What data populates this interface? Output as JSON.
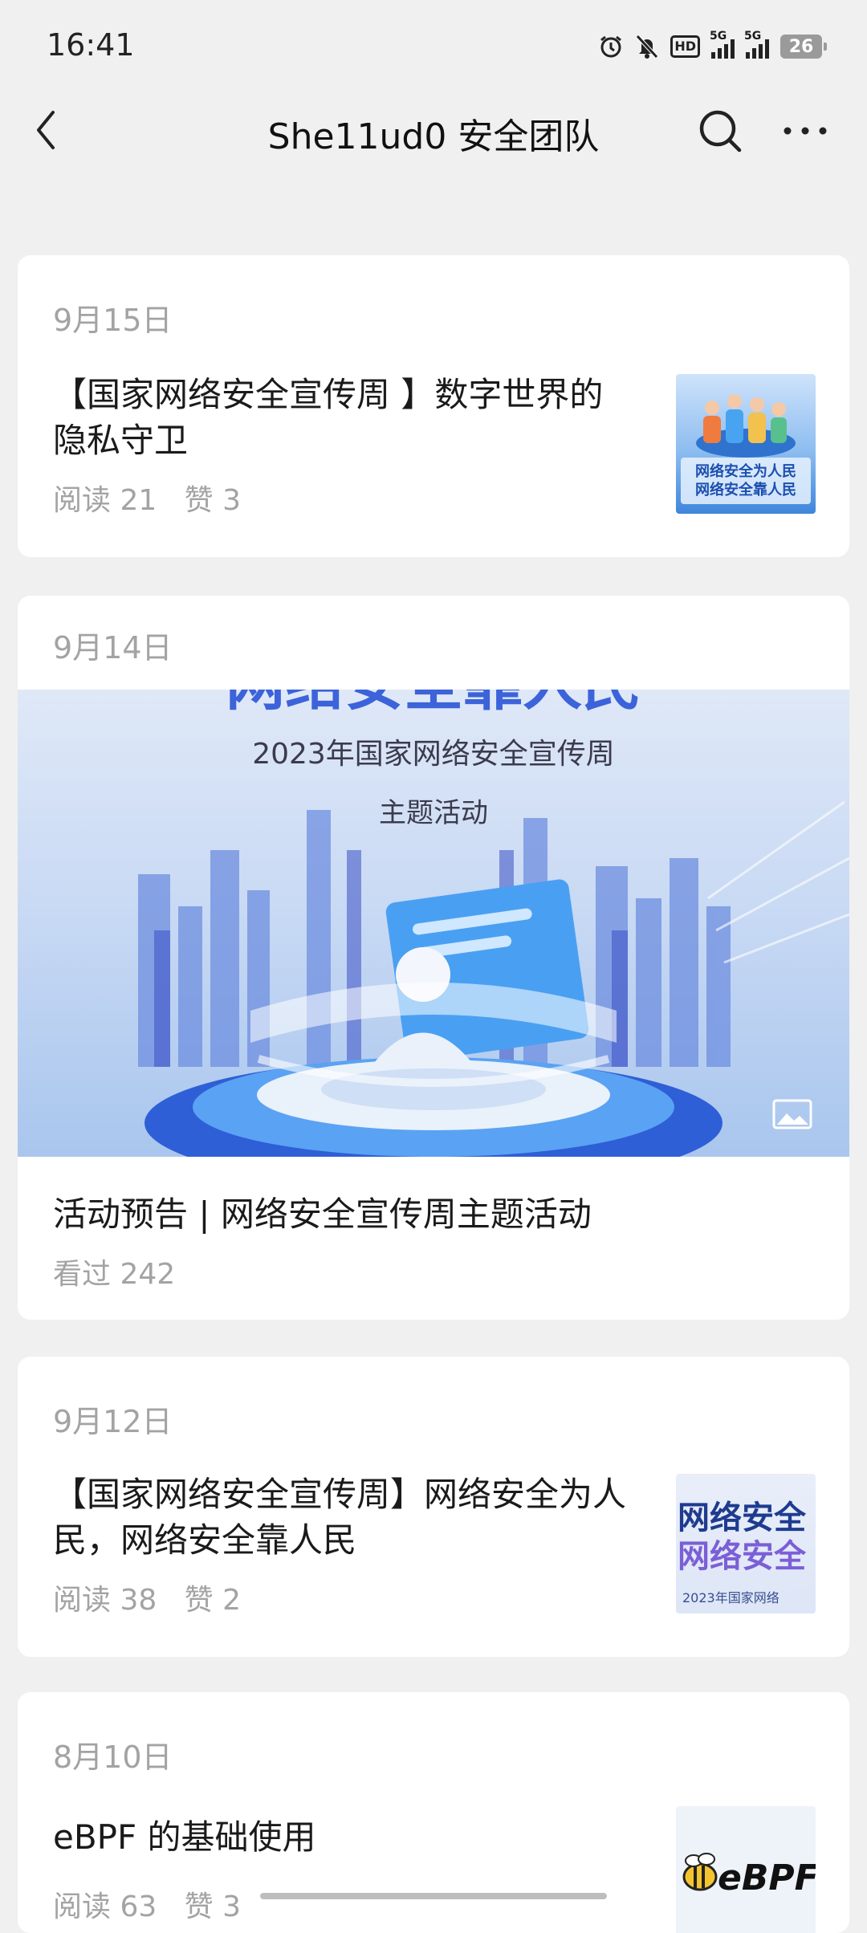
{
  "status_bar": {
    "time": "16:41",
    "battery": "26",
    "network_1": "5G",
    "network_2": "5G",
    "hd": "HD",
    "icons": [
      "alarm-icon",
      "bell-muted-icon",
      "hd-icon",
      "signal-5g-icon",
      "signal-5g-icon",
      "battery-icon"
    ]
  },
  "header": {
    "title": "She11ud0 安全团队",
    "icons": [
      "back-arrow-icon",
      "search-icon",
      "more-icon"
    ]
  },
  "articles": [
    {
      "date": "9月15日",
      "title_line1": "【国家网络安全宣传周 】数字世界的",
      "title_line2": "隐私守卫",
      "read_label": "阅读",
      "read_count": "21",
      "like_label": "赞",
      "like_count": "3",
      "thumb_text_1": "网络安全为人民",
      "thumb_text_2": "网络安全靠人民"
    },
    {
      "date": "9月14日",
      "banner_top": "网络安全靠人民",
      "banner_line1": "2023年国家网络安全宣传周",
      "banner_line2": "主题活动",
      "title": "活动预告 | 网络安全宣传周主题活动",
      "views_label": "看过",
      "views_count": "242",
      "image_icon": "image-icon"
    },
    {
      "date": "9月12日",
      "title_line1": "【国家网络安全宣传周】网络安全为人",
      "title_line2": "民，网络安全靠人民",
      "read_label": "阅读",
      "read_count": "38",
      "like_label": "赞",
      "like_count": "2",
      "thumb_text_1": "网络安全",
      "thumb_text_2": "网络安全",
      "thumb_text_3": "2023年国家网络"
    },
    {
      "date": "8月10日",
      "title": "eBPF 的基础使用",
      "read_label": "阅读",
      "read_count": "63",
      "like_label": "赞",
      "like_count": "3",
      "thumb_text": "eBPF"
    }
  ],
  "colors": {
    "background": "#f0f0f0",
    "card": "#ffffff",
    "muted_text": "#a3a3a3",
    "primary_text": "#1a1a1a",
    "banner_blue": "#3c82e6"
  }
}
